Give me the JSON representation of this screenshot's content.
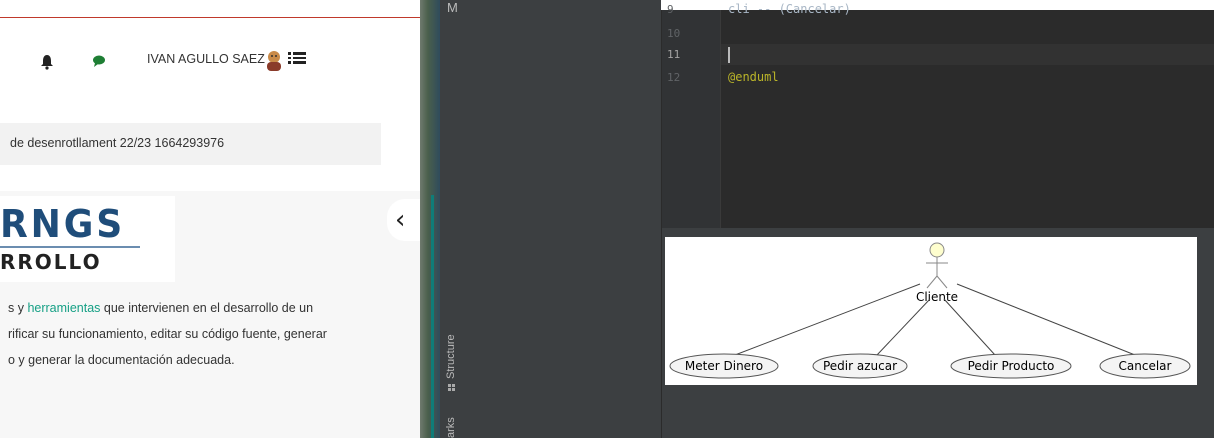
{
  "browser": {
    "header": {
      "user_name": "IVAN AGULLO SAEZ",
      "icons": [
        "bell-icon",
        "chat-icon",
        "avatar",
        "menu-icon"
      ]
    },
    "breadcrumb": "de desenrotllament 22/23 1664293976",
    "logo": {
      "line1": "RNGS",
      "line2": "RROLLO"
    },
    "paragraph": {
      "line1_before": "s y ",
      "line1_link": "herramientas",
      "line1_after": " que intervienen en el desarrollo de un",
      "line2": "rificar su funcionamiento, editar su código fuente, generar",
      "line3": "o y generar la documentación adecuada."
    },
    "collapse_glyph": "‹",
    "colors": {
      "link": "#16a085",
      "accent_line": "#c0392b"
    }
  },
  "ide": {
    "tool_window_tabs": [
      "Structure",
      "arks"
    ],
    "top_letter": "M",
    "editor": {
      "lines": [
        {
          "number": "9",
          "text": "cli -- (Cancelar)"
        },
        {
          "number": "10",
          "text": ""
        },
        {
          "number": "11",
          "text": ""
        },
        {
          "number": "12",
          "text": "@enduml"
        }
      ]
    },
    "diagram": {
      "actor": "Cliente",
      "use_cases": [
        "Meter Dinero",
        "Pedir azucar",
        "Pedir Producto",
        "Cancelar"
      ]
    }
  }
}
